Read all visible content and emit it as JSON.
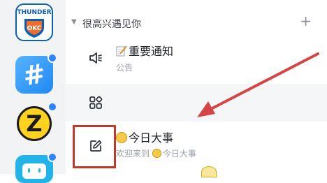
{
  "servers": [
    {
      "name": "THUNDER",
      "icon": "thunder-okc-logo",
      "unread": false
    },
    {
      "name": "hash-server",
      "icon": "hashtag-icon",
      "glyph": "#",
      "unread": true
    },
    {
      "name": "z-server",
      "icon": "z-letter-icon",
      "glyph": "Z",
      "unread": true
    },
    {
      "name": "bili-server",
      "icon": "tv-mascot-icon",
      "unread": true
    }
  ],
  "group": {
    "title": "很高兴遇见你",
    "add_label": "+"
  },
  "channels": {
    "announcement": {
      "icon": "speaker-icon",
      "title": "重要通知",
      "subtitle": "公告"
    },
    "apps": {
      "icon": "apps-grid-icon"
    },
    "today": {
      "icon": "edit-icon",
      "title": "今日大事",
      "subtitle_prefix": "欢迎来到",
      "subtitle_name": "今日大事"
    }
  },
  "colors": {
    "rail_bg": "#f2f3f5",
    "unread_dot": "#2a84ff",
    "highlight": "#c0392b",
    "arrow": "#d64545"
  }
}
